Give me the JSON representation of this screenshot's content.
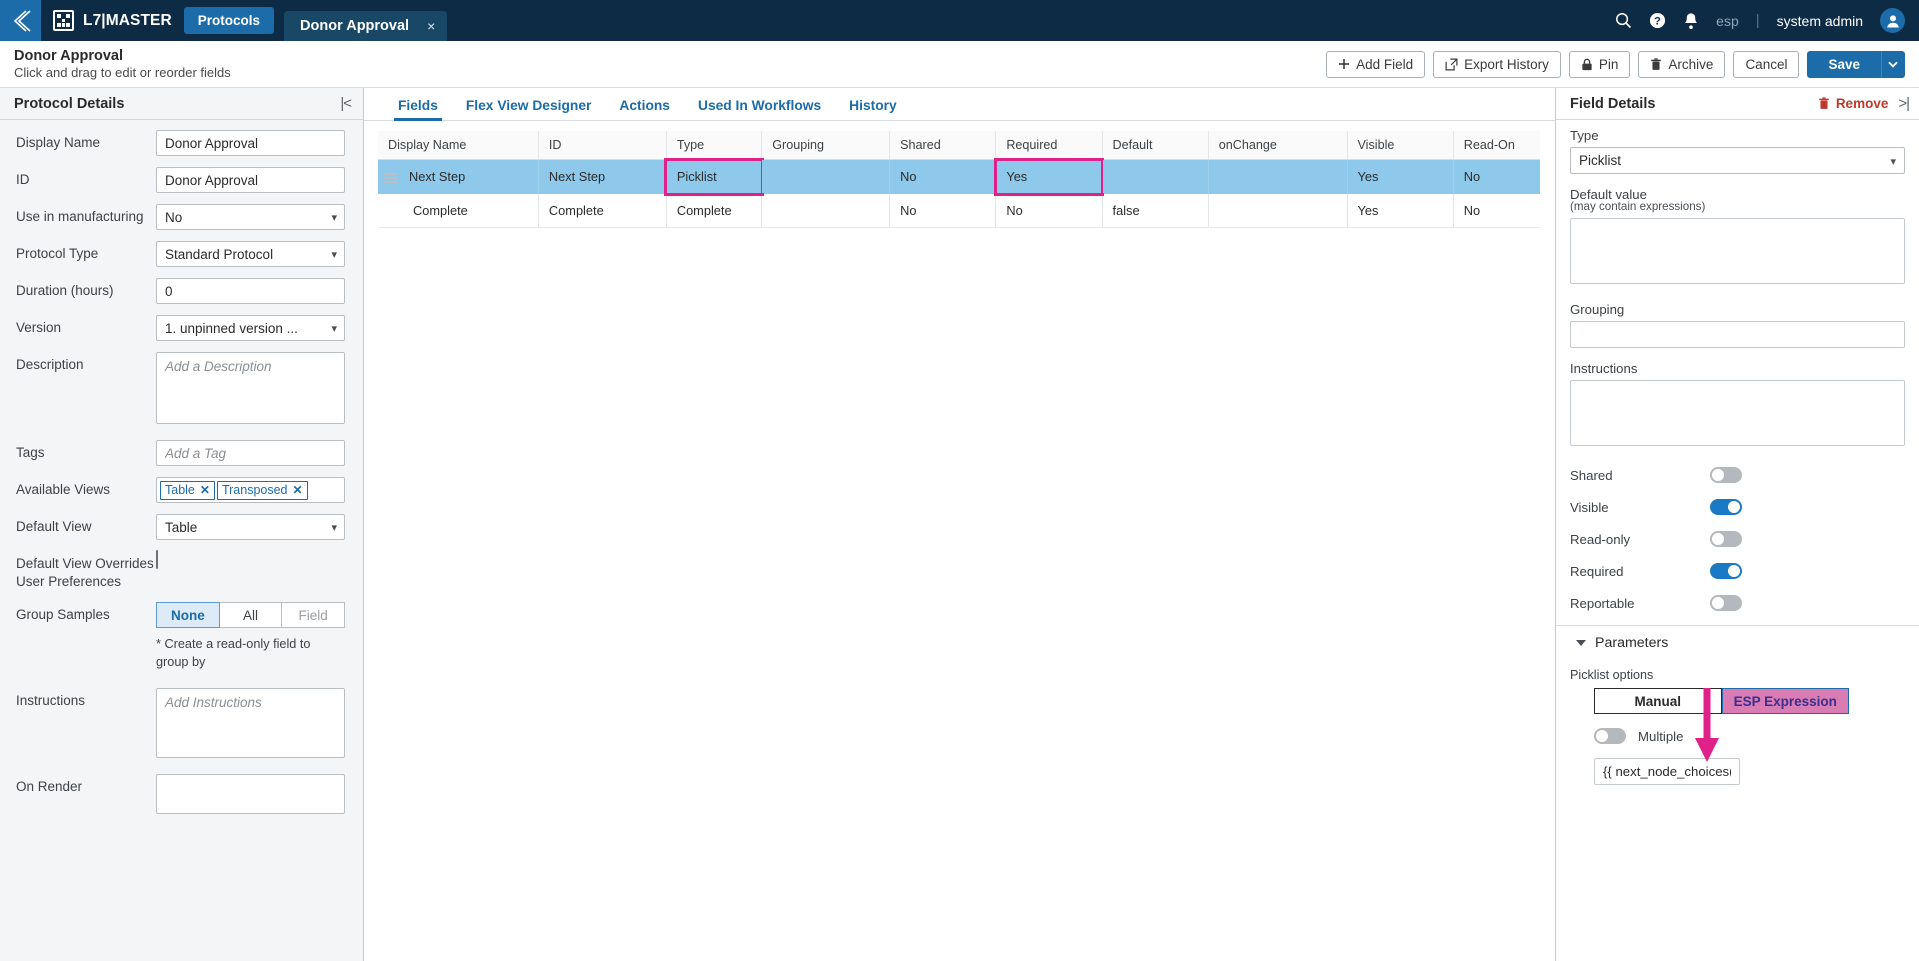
{
  "topbar": {
    "back_icon": "chevron-left-icon",
    "app_icon": "building-add-icon",
    "app_title": "L7|MASTER",
    "nav_tab": "Protocols",
    "doc_tab": "Donor Approval",
    "doc_tab_close": "×",
    "search_icon": "search-icon",
    "help_icon": "help-circle-icon",
    "bell_icon": "notification-bell-icon",
    "esp_label": "esp",
    "divider": "|",
    "user_name": "system admin",
    "avatar_icon": "user-avatar-icon"
  },
  "toolbar": {
    "title": "Donor Approval",
    "subtitle": "Click and drag to edit or reorder fields",
    "add_field": "Add Field",
    "export_history": "Export History",
    "pin": "Pin",
    "archive": "Archive",
    "cancel": "Cancel",
    "save": "Save"
  },
  "left_panel": {
    "title": "Protocol Details",
    "collapse_icon": "collapse-left-icon",
    "fields": {
      "display_name_label": "Display Name",
      "display_name_value": "Donor Approval",
      "id_label": "ID",
      "id_value": "Donor Approval",
      "use_in_manufacturing_label": "Use in manufacturing",
      "use_in_manufacturing_value": "No",
      "protocol_type_label": "Protocol Type",
      "protocol_type_value": "Standard Protocol",
      "duration_label": "Duration (hours)",
      "duration_value": "0",
      "version_label": "Version",
      "version_value": "1. unpinned version ...",
      "description_label": "Description",
      "description_placeholder": "Add a Description",
      "description_value": "",
      "tags_label": "Tags",
      "tags_placeholder": "Add a Tag",
      "tags_value": "",
      "available_views_label": "Available Views",
      "available_views_chips": [
        "Table",
        "Transposed"
      ],
      "default_view_label": "Default View",
      "default_view_value": "Table",
      "default_view_override_label": "Default View Overrides User Preferences",
      "default_view_override_checked": false,
      "group_samples_label": "Group Samples",
      "group_samples_options": [
        "None",
        "All",
        "Field"
      ],
      "group_samples_selected": "None",
      "group_samples_note": "* Create a read-only field to group by",
      "instructions_label": "Instructions",
      "instructions_placeholder": "Add Instructions",
      "instructions_value": "",
      "on_render_label": "On Render",
      "on_render_value": ""
    }
  },
  "center": {
    "tabs": [
      {
        "label": "Fields",
        "active": true
      },
      {
        "label": "Flex View Designer",
        "active": false
      },
      {
        "label": "Actions",
        "active": false
      },
      {
        "label": "Used In Workflows",
        "active": false
      },
      {
        "label": "History",
        "active": false
      }
    ],
    "table": {
      "columns": [
        "Display Name",
        "ID",
        "Type",
        "Grouping",
        "Shared",
        "Required",
        "Default",
        "onChange",
        "Visible",
        "Read-On"
      ],
      "rows": [
        {
          "selected": true,
          "drag_handle": "drag-handle-icon",
          "cells": [
            "Next Step",
            "Next Step",
            "Picklist",
            "",
            "No",
            "Yes",
            "",
            "",
            "Yes",
            "No"
          ],
          "highlighted_cells": [
            2,
            5
          ]
        },
        {
          "selected": false,
          "drag_handle": "",
          "cells": [
            "Complete",
            "Complete",
            "Complete",
            "",
            "No",
            "No",
            "false",
            "",
            "Yes",
            "No"
          ],
          "highlighted_cells": []
        }
      ]
    }
  },
  "right_panel": {
    "title": "Field Details",
    "remove_label": "Remove",
    "remove_icon": "trash-icon",
    "expand_icon": "collapse-right-icon",
    "type_label": "Type",
    "type_value": "Picklist",
    "default_value_label": "Default value",
    "default_value_sub": "(may contain expressions)",
    "default_value": "",
    "grouping_label": "Grouping",
    "grouping_value": "",
    "instructions_label": "Instructions",
    "instructions_value": "",
    "toggles": [
      {
        "label": "Shared",
        "on": false
      },
      {
        "label": "Visible",
        "on": true
      },
      {
        "label": "Read-only",
        "on": false
      },
      {
        "label": "Required",
        "on": true
      },
      {
        "label": "Reportable",
        "on": false
      }
    ],
    "parameters_section": "Parameters",
    "picklist_options_label": "Picklist options",
    "picklist_modes": [
      "Manual",
      "ESP Expression"
    ],
    "picklist_mode_selected": "ESP Expression",
    "multiple_label": "Multiple",
    "multiple_on": false,
    "expression_value": "{{ next_node_choices() }}"
  },
  "colors": {
    "topbar_bg": "#0d2b45",
    "accent_blue": "#1b6ca8",
    "row_selected": "#8ec8ea",
    "highlight_pink": "#e0218a",
    "esp_active_bg": "#d97cb3",
    "remove_red": "#c0392b"
  }
}
